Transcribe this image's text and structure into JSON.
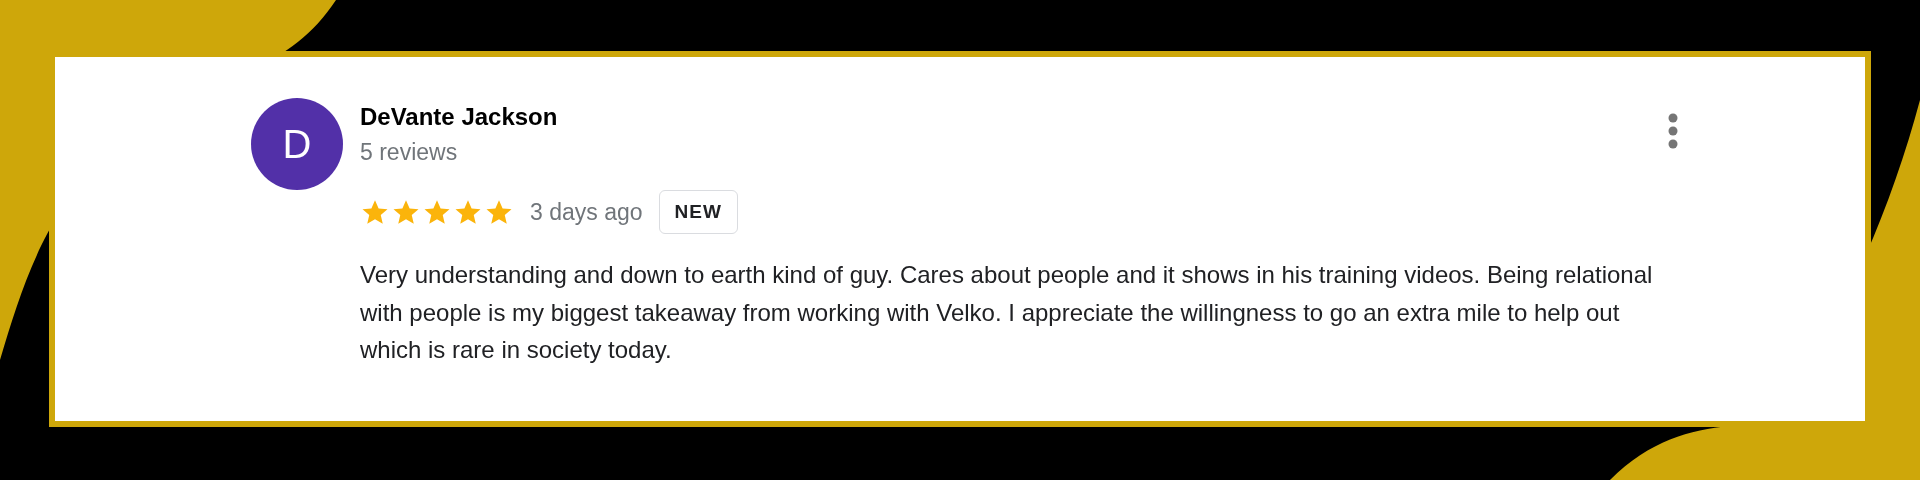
{
  "review": {
    "initial": "D",
    "author": "DeVante Jackson",
    "review_count": "5 reviews",
    "stars": 5,
    "time": "3 days ago",
    "badge": "NEW",
    "text": "Very understanding and down to earth kind of guy. Cares about people and it shows in his training videos. Being relational with people is my biggest takeaway from working with Velko. I appreciate the willingness to go an extra mile to help out which is rare in society today."
  }
}
